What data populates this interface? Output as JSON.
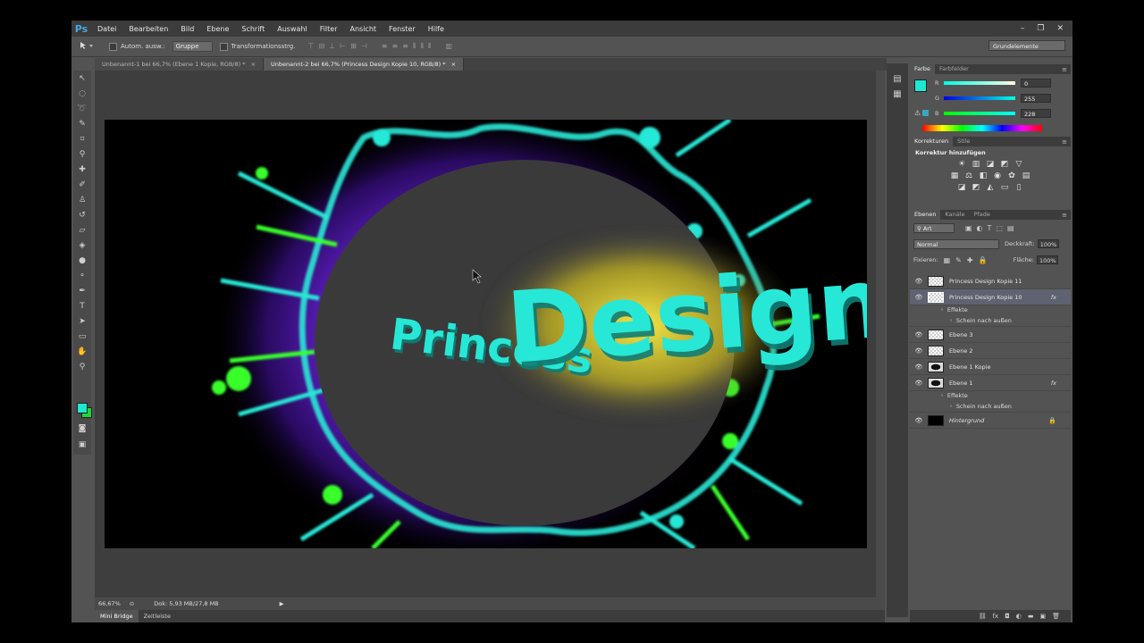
{
  "menubar": {
    "logo": "Ps",
    "items": [
      "Datei",
      "Bearbeiten",
      "Bild",
      "Ebene",
      "Schrift",
      "Auswahl",
      "Filter",
      "Ansicht",
      "Fenster",
      "Hilfe"
    ],
    "window_buttons": [
      "–",
      "❐",
      "✕"
    ]
  },
  "options_bar": {
    "auto_select_label": "Autom. ausw.:",
    "auto_select_value": "Gruppe",
    "transform_label": "Transformationsstrg.",
    "workspace": "Grundelemente"
  },
  "documents": {
    "tabs": [
      {
        "label": "Unbenannt-1 bei 66,7% (Ebene 1 Kopie, RGB/8) *",
        "active": false
      },
      {
        "label": "Unbenannt-2 bei 66,7% (Princess Design Kopie 10, RGB/8) *",
        "active": true
      }
    ],
    "close_glyph": "×"
  },
  "artwork": {
    "text_small": "Princess",
    "text_large": "Design",
    "colors": {
      "neon_cyan": "#27e8d6",
      "neon_green": "#39ff2a",
      "purple": "#5b1fc8",
      "glow": "#fff23a",
      "ellipse": "#3a3a3a"
    }
  },
  "status_bar": {
    "zoom": "66,67%",
    "doc_info": "Dok: 5,93 MB/27,8 MB"
  },
  "bottom_tabs": [
    "Mini Bridge",
    "Zeitleiste"
  ],
  "color_panel": {
    "tabs": [
      "Farbe",
      "Farbfelder"
    ],
    "fg_color": "#1de8d2",
    "bg_color": "#1ed83a",
    "channels": [
      {
        "label": "R",
        "value": "0"
      },
      {
        "label": "G",
        "value": "255"
      },
      {
        "label": "B",
        "value": "228"
      }
    ]
  },
  "adjustments_panel": {
    "tabs": [
      "Korrekturen",
      "Stile"
    ],
    "heading": "Korrektur hinzufügen"
  },
  "layers_panel": {
    "tabs": [
      "Ebenen",
      "Kanäle",
      "Pfade"
    ],
    "filter_kind": "Art",
    "blend_mode": "Normal",
    "opacity_label": "Deckkraft:",
    "opacity_value": "100%",
    "lock_label": "Fixieren:",
    "fill_label": "Fläche:",
    "fill_value": "100%",
    "effects_label": "Effekte",
    "fx_label": "fx",
    "layers": [
      {
        "name": "Princess Design Kopie 11",
        "thumb": "text",
        "selected": false
      },
      {
        "name": "Princess Design Kopie 10",
        "thumb": "text",
        "selected": true,
        "fx": true,
        "effect": "Schein nach außen"
      },
      {
        "name": "Ebene 3",
        "thumb": "trans",
        "selected": false
      },
      {
        "name": "Ebene 2",
        "thumb": "trans",
        "selected": false
      },
      {
        "name": "Ebene 1 Kopie",
        "thumb": "dark",
        "selected": false
      },
      {
        "name": "Ebene 1",
        "thumb": "dark",
        "selected": false,
        "fx": true,
        "effect": "Schein nach außen"
      },
      {
        "name": "Hintergrund",
        "thumb": "black",
        "selected": false,
        "locked": true
      }
    ]
  }
}
